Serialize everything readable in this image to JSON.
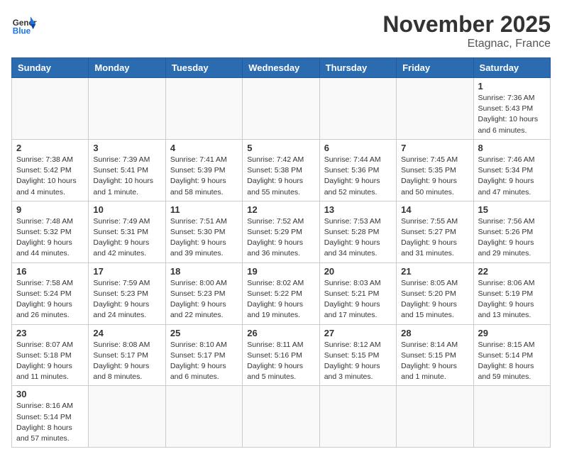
{
  "header": {
    "logo_general": "General",
    "logo_blue": "Blue",
    "month_title": "November 2025",
    "location": "Etagnac, France"
  },
  "weekdays": [
    "Sunday",
    "Monday",
    "Tuesday",
    "Wednesday",
    "Thursday",
    "Friday",
    "Saturday"
  ],
  "weeks": [
    [
      {
        "day": "",
        "info": ""
      },
      {
        "day": "",
        "info": ""
      },
      {
        "day": "",
        "info": ""
      },
      {
        "day": "",
        "info": ""
      },
      {
        "day": "",
        "info": ""
      },
      {
        "day": "",
        "info": ""
      },
      {
        "day": "1",
        "info": "Sunrise: 7:36 AM\nSunset: 5:43 PM\nDaylight: 10 hours and 6 minutes."
      }
    ],
    [
      {
        "day": "2",
        "info": "Sunrise: 7:38 AM\nSunset: 5:42 PM\nDaylight: 10 hours and 4 minutes."
      },
      {
        "day": "3",
        "info": "Sunrise: 7:39 AM\nSunset: 5:41 PM\nDaylight: 10 hours and 1 minute."
      },
      {
        "day": "4",
        "info": "Sunrise: 7:41 AM\nSunset: 5:39 PM\nDaylight: 9 hours and 58 minutes."
      },
      {
        "day": "5",
        "info": "Sunrise: 7:42 AM\nSunset: 5:38 PM\nDaylight: 9 hours and 55 minutes."
      },
      {
        "day": "6",
        "info": "Sunrise: 7:44 AM\nSunset: 5:36 PM\nDaylight: 9 hours and 52 minutes."
      },
      {
        "day": "7",
        "info": "Sunrise: 7:45 AM\nSunset: 5:35 PM\nDaylight: 9 hours and 50 minutes."
      },
      {
        "day": "8",
        "info": "Sunrise: 7:46 AM\nSunset: 5:34 PM\nDaylight: 9 hours and 47 minutes."
      }
    ],
    [
      {
        "day": "9",
        "info": "Sunrise: 7:48 AM\nSunset: 5:32 PM\nDaylight: 9 hours and 44 minutes."
      },
      {
        "day": "10",
        "info": "Sunrise: 7:49 AM\nSunset: 5:31 PM\nDaylight: 9 hours and 42 minutes."
      },
      {
        "day": "11",
        "info": "Sunrise: 7:51 AM\nSunset: 5:30 PM\nDaylight: 9 hours and 39 minutes."
      },
      {
        "day": "12",
        "info": "Sunrise: 7:52 AM\nSunset: 5:29 PM\nDaylight: 9 hours and 36 minutes."
      },
      {
        "day": "13",
        "info": "Sunrise: 7:53 AM\nSunset: 5:28 PM\nDaylight: 9 hours and 34 minutes."
      },
      {
        "day": "14",
        "info": "Sunrise: 7:55 AM\nSunset: 5:27 PM\nDaylight: 9 hours and 31 minutes."
      },
      {
        "day": "15",
        "info": "Sunrise: 7:56 AM\nSunset: 5:26 PM\nDaylight: 9 hours and 29 minutes."
      }
    ],
    [
      {
        "day": "16",
        "info": "Sunrise: 7:58 AM\nSunset: 5:24 PM\nDaylight: 9 hours and 26 minutes."
      },
      {
        "day": "17",
        "info": "Sunrise: 7:59 AM\nSunset: 5:23 PM\nDaylight: 9 hours and 24 minutes."
      },
      {
        "day": "18",
        "info": "Sunrise: 8:00 AM\nSunset: 5:23 PM\nDaylight: 9 hours and 22 minutes."
      },
      {
        "day": "19",
        "info": "Sunrise: 8:02 AM\nSunset: 5:22 PM\nDaylight: 9 hours and 19 minutes."
      },
      {
        "day": "20",
        "info": "Sunrise: 8:03 AM\nSunset: 5:21 PM\nDaylight: 9 hours and 17 minutes."
      },
      {
        "day": "21",
        "info": "Sunrise: 8:05 AM\nSunset: 5:20 PM\nDaylight: 9 hours and 15 minutes."
      },
      {
        "day": "22",
        "info": "Sunrise: 8:06 AM\nSunset: 5:19 PM\nDaylight: 9 hours and 13 minutes."
      }
    ],
    [
      {
        "day": "23",
        "info": "Sunrise: 8:07 AM\nSunset: 5:18 PM\nDaylight: 9 hours and 11 minutes."
      },
      {
        "day": "24",
        "info": "Sunrise: 8:08 AM\nSunset: 5:17 PM\nDaylight: 9 hours and 8 minutes."
      },
      {
        "day": "25",
        "info": "Sunrise: 8:10 AM\nSunset: 5:17 PM\nDaylight: 9 hours and 6 minutes."
      },
      {
        "day": "26",
        "info": "Sunrise: 8:11 AM\nSunset: 5:16 PM\nDaylight: 9 hours and 5 minutes."
      },
      {
        "day": "27",
        "info": "Sunrise: 8:12 AM\nSunset: 5:15 PM\nDaylight: 9 hours and 3 minutes."
      },
      {
        "day": "28",
        "info": "Sunrise: 8:14 AM\nSunset: 5:15 PM\nDaylight: 9 hours and 1 minute."
      },
      {
        "day": "29",
        "info": "Sunrise: 8:15 AM\nSunset: 5:14 PM\nDaylight: 8 hours and 59 minutes."
      }
    ],
    [
      {
        "day": "30",
        "info": "Sunrise: 8:16 AM\nSunset: 5:14 PM\nDaylight: 8 hours and 57 minutes."
      },
      {
        "day": "",
        "info": ""
      },
      {
        "day": "",
        "info": ""
      },
      {
        "day": "",
        "info": ""
      },
      {
        "day": "",
        "info": ""
      },
      {
        "day": "",
        "info": ""
      },
      {
        "day": "",
        "info": ""
      }
    ]
  ]
}
